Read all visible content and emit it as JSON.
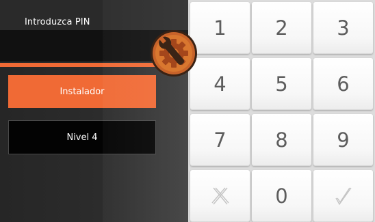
{
  "header": {
    "title": "Introduzca PIN"
  },
  "roles": {
    "installer_label": "Instalador",
    "level_label": "Nivel 4"
  },
  "keypad": {
    "k1": "1",
    "k2": "2",
    "k3": "3",
    "k4": "4",
    "k5": "5",
    "k6": "6",
    "k7": "7",
    "k8": "8",
    "k9": "9",
    "k0": "0",
    "clear_icon": "x-icon",
    "confirm_icon": "check-icon"
  },
  "colors": {
    "accent": "#f06a35",
    "badge": "#c8632a",
    "panel_dark": "#111111",
    "key_text": "#5d5d5d"
  }
}
